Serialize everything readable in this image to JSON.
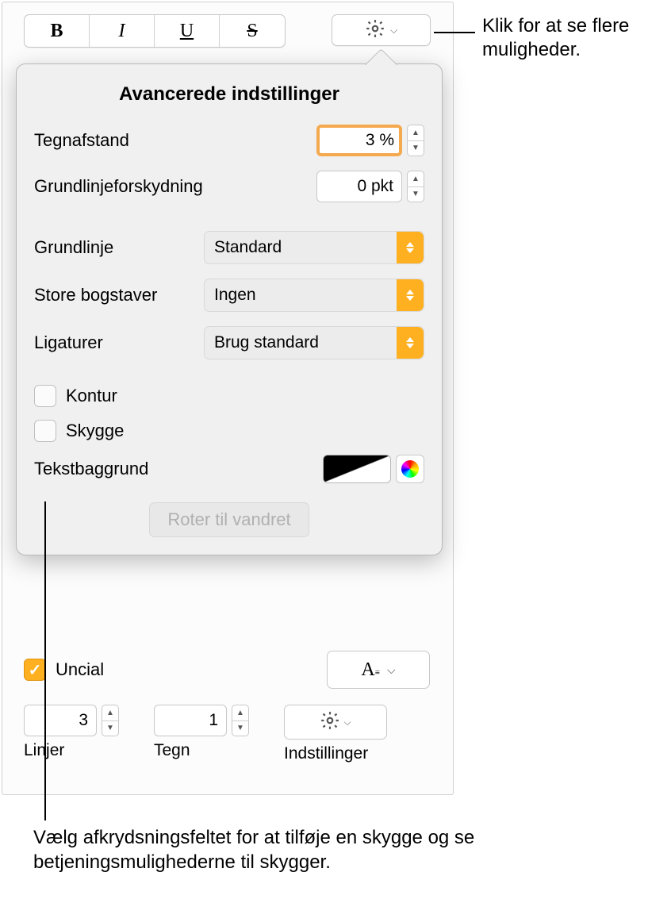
{
  "callouts": {
    "top": "Klik for at se flere muligheder.",
    "bottom": "Vælg afkrydsningsfeltet for at tilføje en skygge og se betjeningsmulighederne til skygger."
  },
  "toolbar": {
    "bold": "B",
    "italic": "I",
    "underline": "U",
    "strike": "S"
  },
  "popover": {
    "title": "Avancerede indstillinger",
    "tegnafstand_label": "Tegnafstand",
    "tegnafstand_value": "3 %",
    "grundlinjeforskydning_label": "Grundlinjeforskydning",
    "grundlinjeforskydning_value": "0 pkt",
    "grundlinje_label": "Grundlinje",
    "grundlinje_value": "Standard",
    "storebogstaver_label": "Store bogstaver",
    "storebogstaver_value": "Ingen",
    "ligaturer_label": "Ligaturer",
    "ligaturer_value": "Brug standard",
    "kontur_label": "Kontur",
    "skygge_label": "Skygge",
    "tekstbaggrund_label": "Tekstbaggrund",
    "rotate_label": "Roter til vandret"
  },
  "bottom": {
    "uncial_label": "Uncial",
    "linjer_value": "3",
    "linjer_label": "Linjer",
    "tegn_value": "1",
    "tegn_label": "Tegn",
    "indstillinger_label": "Indstillinger"
  }
}
